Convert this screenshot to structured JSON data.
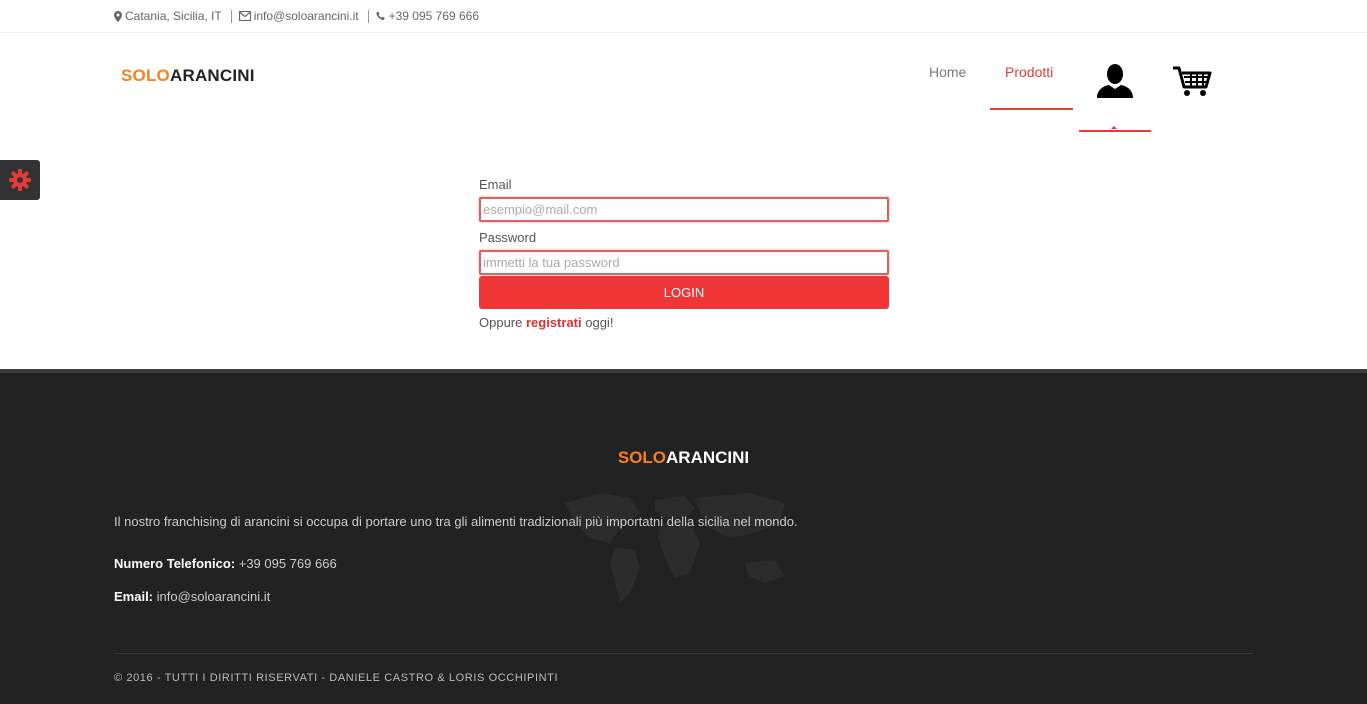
{
  "topbar": {
    "location": "Catania, Sicilia, IT",
    "email": "info@soloarancini.it",
    "phone": "+39 095 769 666"
  },
  "brand": {
    "part1": "SOLO",
    "part2": "ARANCINI",
    "color_part1": "#f7811f"
  },
  "nav": {
    "home": "Home",
    "prodotti": "Prodotti",
    "user_icon": "user-icon",
    "cart_icon": "cart-icon",
    "accent": "#e43a3a"
  },
  "settings_tab": {
    "icon": "gear-icon"
  },
  "login_form": {
    "email_label": "Email",
    "email_placeholder": "esempio@mail.com",
    "password_label": "Password",
    "password_placeholder": "immetti la tua password",
    "login_button": "LOGIN",
    "register_prefix": "Oppure ",
    "register_link": "registrati",
    "register_suffix": " oggi!",
    "button_color": "#ef3535"
  },
  "footer": {
    "brand_part1": "SOLO",
    "brand_part2": "ARANCINI",
    "description": "Il nostro franchising di arancini si occupa di portare uno tra gli alimenti tradizionali più importatni della sicilia nel mondo.",
    "phone_label": "Numero Telefonico:",
    "phone_value": " +39 095 769 666",
    "email_label": "Email:",
    "email_value": " info@soloarancini.it",
    "copyright": "© 2016 - TUTTI I DIRITTI RISERVATI - DANIELE CASTRO & LORIS OCCHIPINTI",
    "background": "#222222",
    "decoration_icon": "world-map-icon"
  }
}
